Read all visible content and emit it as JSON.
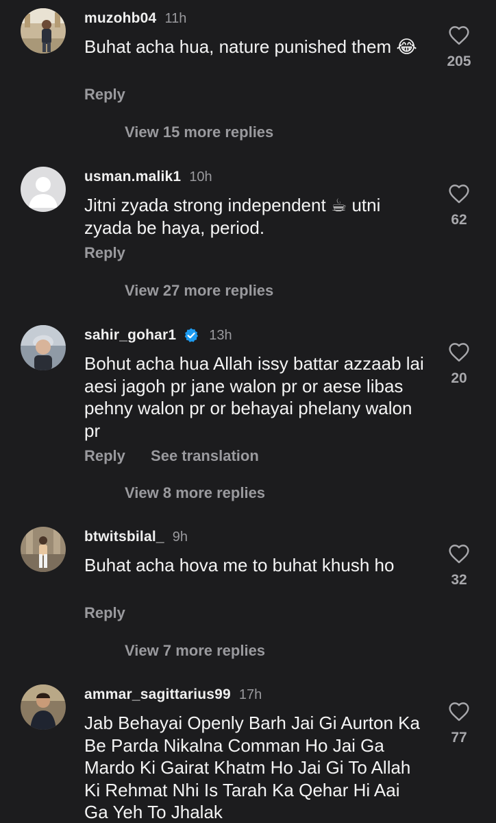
{
  "comments": [
    {
      "username": "muzohb04",
      "time": "11h",
      "verified": false,
      "text": "Buhat acha hua, nature punished them 😂",
      "reply_label": "Reply",
      "likes": "205",
      "view_replies": "View 15 more replies"
    },
    {
      "username": "usman.malik1",
      "time": "10h",
      "verified": false,
      "text": "Jitni zyada strong independent ☕ utni zyada be haya, period.",
      "reply_label": "Reply",
      "likes": "62",
      "view_replies": "View 27 more replies"
    },
    {
      "username": "sahir_gohar1",
      "time": "13h",
      "verified": true,
      "text": "Bohut acha hua Allah issy battar azzaab lai aesi jagoh pr jane walon pr or aese libas pehny walon pr or behayai phelany walon pr",
      "reply_label": "Reply",
      "translation_label": "See translation",
      "likes": "20",
      "view_replies": "View 8 more replies"
    },
    {
      "username": "btwitsbilal_",
      "time": "9h",
      "verified": false,
      "text": "Buhat acha hova me to buhat khush ho",
      "reply_label": "Reply",
      "likes": "32",
      "view_replies": "View 7 more replies"
    },
    {
      "username": "ammar_sagittarius99",
      "time": "17h",
      "verified": false,
      "text": "Jab Behayai Openly Barh Jai Gi Aurton Ka Be Parda Nikalna Comman Ho Jai Ga Mardo Ki Gairat Khatm Ho Jai Gi To Allah Ki Rehmat Nhi Is Tarah Ka Qehar Hi Aai Ga Yeh To Jhalak",
      "likes": "77"
    }
  ],
  "colors": {
    "background": "#1c1c1e",
    "text_primary": "#f2f2f2",
    "text_secondary": "#9a9a9e",
    "verified_badge": "#1d9bf0"
  },
  "icons": [
    "heart-icon",
    "verified-badge-icon",
    "default-avatar-icon"
  ]
}
